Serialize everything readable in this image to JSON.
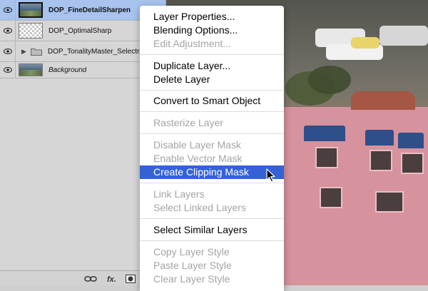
{
  "layers_panel": {
    "layers": [
      {
        "name": "DOP_FineDetailSharpen",
        "type": "photo",
        "selected": true
      },
      {
        "name": "DOP_OptimalSharp",
        "type": "checker",
        "selected": false
      },
      {
        "name": "DOP_TonalityMaster_Selectri",
        "type": "group",
        "selected": false
      },
      {
        "name": "Background",
        "type": "photo",
        "selected": false
      }
    ],
    "bottom_icons": [
      "link-icon",
      "fx-icon",
      "mask-icon"
    ],
    "fx_label": "fx."
  },
  "context_menu": {
    "items": [
      {
        "label": "Layer Properties...",
        "enabled": true
      },
      {
        "label": "Blending Options...",
        "enabled": true
      },
      {
        "label": "Edit Adjustment...",
        "enabled": false
      },
      {
        "label": "Duplicate Layer...",
        "enabled": true
      },
      {
        "label": "Delete Layer",
        "enabled": true
      },
      {
        "label": "Convert to Smart Object",
        "enabled": true
      },
      {
        "label": "Rasterize Layer",
        "enabled": false
      },
      {
        "label": "Disable Layer Mask",
        "enabled": false
      },
      {
        "label": "Enable Vector Mask",
        "enabled": false
      },
      {
        "label": "Create Clipping Mask",
        "enabled": true,
        "highlighted": true
      },
      {
        "label": "Link Layers",
        "enabled": false
      },
      {
        "label": "Select Linked Layers",
        "enabled": false
      },
      {
        "label": "Select Similar Layers",
        "enabled": true
      },
      {
        "label": "Copy Layer Style",
        "enabled": false
      },
      {
        "label": "Paste Layer Style",
        "enabled": false
      },
      {
        "label": "Clear Layer Style",
        "enabled": false
      }
    ]
  },
  "colors": {
    "selection_blue": "#3462d6",
    "selected_layer_bg": "#a7c3ee",
    "disabled_text": "#a4a4a4"
  }
}
